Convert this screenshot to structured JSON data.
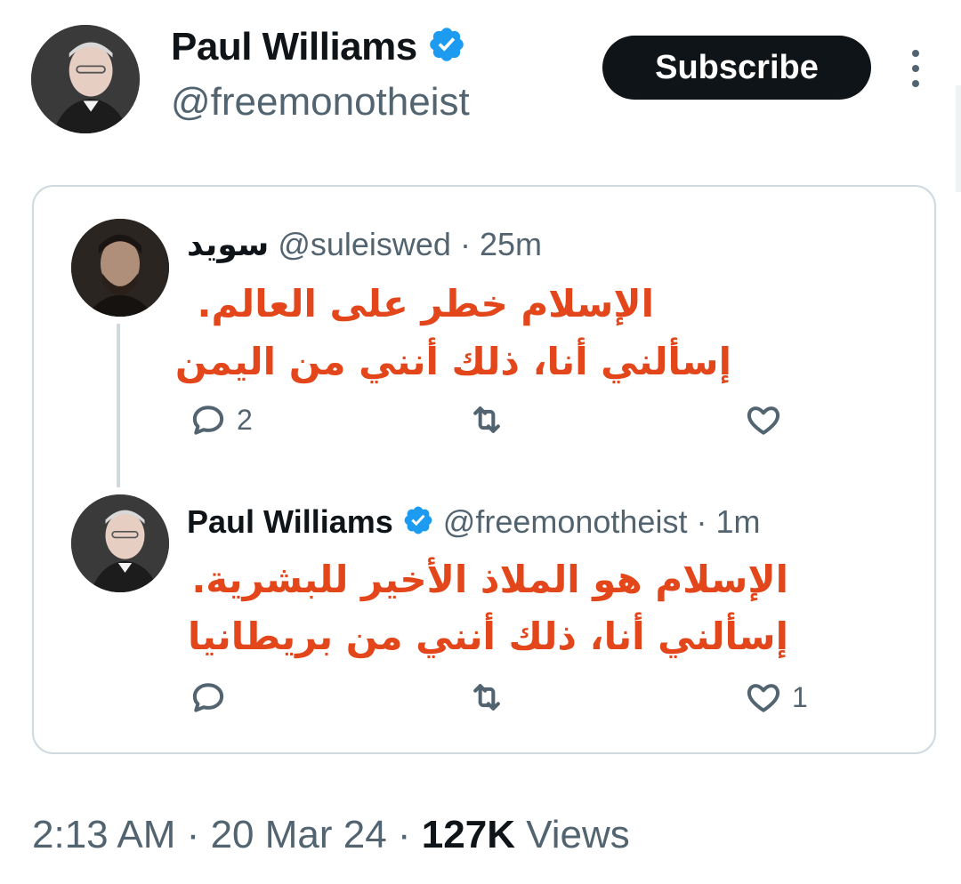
{
  "tweet": {
    "author_name": "Paul Williams",
    "author_handle": "@freemonotheist",
    "subscribe_label": "Subscribe",
    "time": "2:13 AM",
    "date": "20 Mar 24",
    "views_count": "127K",
    "views_label": "Views",
    "separator": "·"
  },
  "quote": {
    "tweets": [
      {
        "author_name": "سويد",
        "author_handle": "@suleiswed",
        "age": "25m",
        "text_lines": [
          "الإسلام خطر على العالم.",
          "إسألني أنا، ذلك أنني من اليمن"
        ],
        "reply_count": "2",
        "like_count": ""
      },
      {
        "author_name": "Paul Williams",
        "author_handle": "@freemonotheist",
        "age": "1m",
        "text_lines": [
          "الإسلام هو الملاذ الأخير للبشرية.",
          "إسألني أنا، ذلك أنني من بريطانيا"
        ],
        "reply_count": "",
        "like_count": "1"
      }
    ]
  },
  "colors": {
    "accent_blue": "#1d9bf0",
    "text_primary": "#0f1419",
    "text_secondary": "#536471",
    "arabic_text": "#e2461a",
    "border": "#cfd9de"
  },
  "icons": {
    "verified": "verified-badge-icon",
    "more": "more-vertical-icon",
    "reply": "reply-icon",
    "retweet": "retweet-icon",
    "like": "heart-icon"
  }
}
